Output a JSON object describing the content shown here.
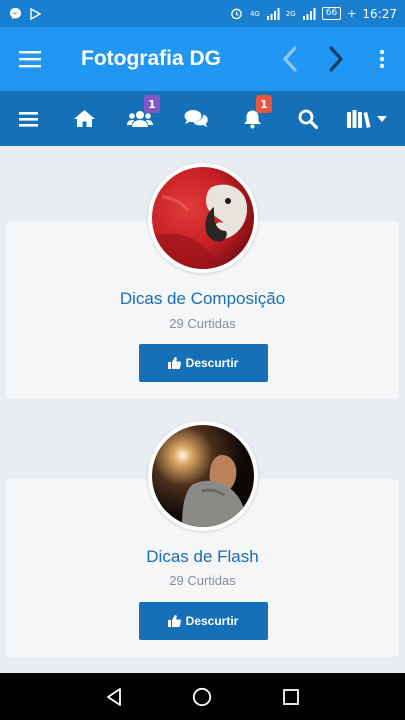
{
  "status_bar": {
    "left_icons": [
      "messenger-icon",
      "play-icon"
    ],
    "right_icons": [
      "alarm-icon",
      "signal-icon",
      "signal-icon"
    ],
    "network_1": "4G",
    "network_2": "2G",
    "battery": "66",
    "time": "16:27"
  },
  "app_bar": {
    "title": "Fotografia DG",
    "icons": [
      "menu-icon",
      "back-icon",
      "forward-icon",
      "more-vert-icon"
    ]
  },
  "toolbar": {
    "items": [
      {
        "icon": "menu-icon"
      },
      {
        "icon": "home-icon"
      },
      {
        "icon": "users-icon",
        "badge": "1"
      },
      {
        "icon": "chat-icon"
      },
      {
        "icon": "bell-icon",
        "badge": "1"
      },
      {
        "icon": "search-icon"
      },
      {
        "icon": "library-icon"
      }
    ],
    "colors": {
      "bar": "#1570b8",
      "appbar": "#2196f3",
      "badge_purple": "#8457c8",
      "badge_red": "#e8553d"
    }
  },
  "cards": [
    {
      "title": "Dicas de Composição",
      "likes": "29 Curtidas",
      "button": "Descurtir",
      "image": "parrot-photo"
    },
    {
      "title": "Dicas de Flash",
      "likes": "29 Curtidas",
      "button": "Descurtir",
      "image": "flash-portrait-photo"
    }
  ],
  "nav_bar": {
    "icons": [
      "back-triangle-icon",
      "home-circle-icon",
      "recents-square-icon"
    ]
  }
}
